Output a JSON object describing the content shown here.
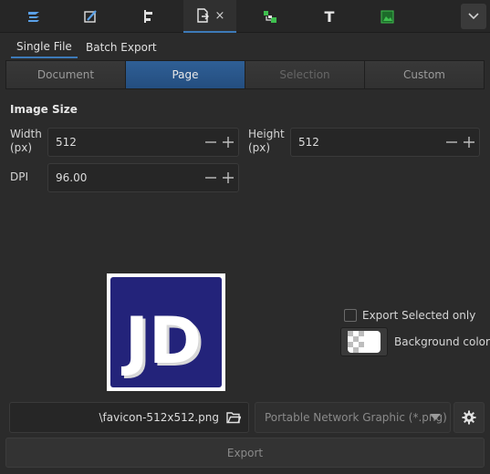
{
  "toolbar": {
    "tabs": [
      {
        "icon": "layers-icon"
      },
      {
        "icon": "fill-stroke-icon"
      },
      {
        "icon": "align-distribute-icon"
      },
      {
        "icon": "export-document-icon",
        "active": true,
        "close": "×"
      },
      {
        "icon": "xml-editor-icon"
      },
      {
        "icon": "text-font-icon",
        "glyph": "T"
      },
      {
        "icon": "image-icon"
      }
    ],
    "menu_icon": "chevron-down-icon"
  },
  "subtabs": {
    "single_file": "Single File",
    "batch_export": "Batch Export"
  },
  "area": {
    "document": "Document",
    "page": "Page",
    "selection": "Selection",
    "custom": "Custom"
  },
  "image_size": {
    "title": "Image Size",
    "width_label": "Width (px)",
    "width_value": "512",
    "height_label": "Height (px)",
    "height_value": "512",
    "dpi_label": "DPI",
    "dpi_value": "96.00"
  },
  "preview": {
    "logo_text": "JD",
    "logo_bg": "#23237a"
  },
  "options": {
    "export_selected_only": "Export Selected only",
    "export_selected_checked": false,
    "background_color": "Background color"
  },
  "file": {
    "filename": "\\favicon-512x512.png",
    "format": "Portable Network Graphic (*.png)"
  },
  "export_button": "Export",
  "colors": {
    "accent": "#3d7ab8",
    "active_segment": "#2a5a8f"
  }
}
